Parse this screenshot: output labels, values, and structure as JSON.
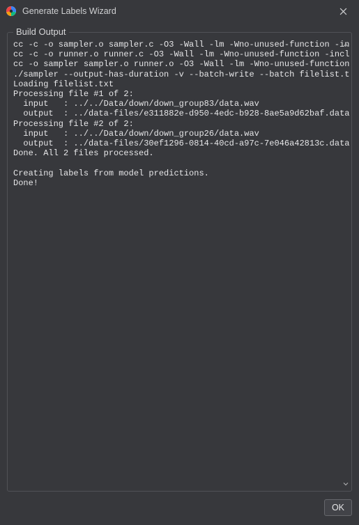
{
  "window": {
    "title": "Generate Labels Wizard"
  },
  "group": {
    "label": "Build Output"
  },
  "output_lines": [
    "cc -c -o sampler.o sampler.c -O3 -Wall -lm -Wno-unused-function -include",
    "cc -c -o runner.o runner.c -O3 -Wall -lm -Wno-unused-function -include",
    "cc -o sampler sampler.o runner.o -O3 -Wall -lm -Wno-unused-function",
    "./sampler --output-has-duration -v --batch-write --batch filelist.txt -",
    "Loading filelist.txt",
    "Processing file #1 of 2:",
    "  input   : ../../Data/down/down_group83/data.wav",
    "  output  : ../data-files/e311882e-d950-4edc-b928-8ae5a9d62baf.data",
    "Processing file #2 of 2:",
    "  input   : ../../Data/down/down_group26/data.wav",
    "  output  : ../data-files/30ef1296-0814-40cd-a97c-7e046a42813c.data",
    "Done. All 2 files processed.",
    "",
    "Creating labels from model predictions.",
    "Done!"
  ],
  "footer": {
    "ok_label": "OK"
  },
  "icons": {
    "app": "app-icon",
    "close": "close-icon",
    "scroll_up": "chevron-up-icon",
    "scroll_down": "chevron-down-icon"
  }
}
